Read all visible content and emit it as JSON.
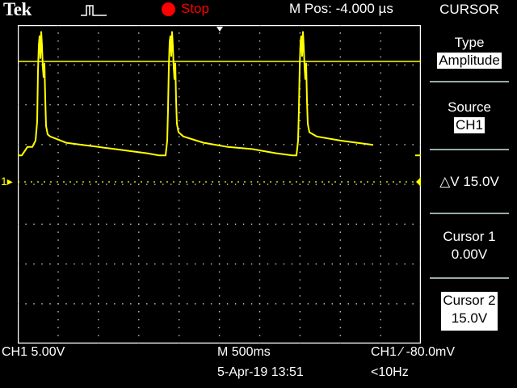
{
  "header": {
    "brand": "Tek",
    "trigger_icon": "single-pulse-icon",
    "run_state": "Stop",
    "mpos": "M Pos: -4.000 µs"
  },
  "colors": {
    "trace": "#ffff00",
    "grid": "#ffffff",
    "stop": "#ff0000",
    "border": "#ffffff"
  },
  "display": {
    "channel_marker": "1▸",
    "trace_points": [
      [
        0,
        0.62
      ],
      [
        5,
        0.62
      ],
      [
        12,
        0.58
      ],
      [
        18,
        0.58
      ],
      [
        22,
        0.55
      ],
      [
        24,
        0.46
      ],
      [
        25,
        0.22
      ],
      [
        26,
        0.1
      ],
      [
        27,
        0.05
      ],
      [
        28,
        0.16
      ],
      [
        29,
        0.03
      ],
      [
        30,
        0.1
      ],
      [
        31,
        0.2
      ],
      [
        32,
        0.25
      ],
      [
        33,
        0.18
      ],
      [
        34,
        0.35
      ],
      [
        35,
        0.48
      ],
      [
        37,
        0.52
      ],
      [
        40,
        0.53
      ],
      [
        60,
        0.56
      ],
      [
        80,
        0.57
      ],
      [
        100,
        0.58
      ],
      [
        120,
        0.59
      ],
      [
        140,
        0.6
      ],
      [
        160,
        0.61
      ],
      [
        175,
        0.62
      ],
      [
        183,
        0.62
      ],
      [
        185,
        0.55
      ],
      [
        186,
        0.4
      ],
      [
        187,
        0.2
      ],
      [
        188,
        0.08
      ],
      [
        189,
        0.05
      ],
      [
        190,
        0.15
      ],
      [
        191,
        0.03
      ],
      [
        192,
        0.1
      ],
      [
        193,
        0.2
      ],
      [
        194,
        0.26
      ],
      [
        195,
        0.18
      ],
      [
        196,
        0.36
      ],
      [
        197,
        0.47
      ],
      [
        199,
        0.51
      ],
      [
        205,
        0.53
      ],
      [
        230,
        0.56
      ],
      [
        260,
        0.58
      ],
      [
        290,
        0.59
      ],
      [
        320,
        0.61
      ],
      [
        340,
        0.62
      ],
      [
        345,
        0.62
      ],
      [
        347,
        0.55
      ],
      [
        348,
        0.4
      ],
      [
        349,
        0.2
      ],
      [
        350,
        0.08
      ],
      [
        351,
        0.05
      ],
      [
        352,
        0.15
      ],
      [
        353,
        0.03
      ],
      [
        354,
        0.1
      ],
      [
        355,
        0.2
      ],
      [
        356,
        0.26
      ],
      [
        357,
        0.18
      ],
      [
        358,
        0.36
      ],
      [
        359,
        0.47
      ],
      [
        361,
        0.51
      ],
      [
        370,
        0.53
      ],
      [
        400,
        0.55
      ],
      [
        420,
        0.56
      ],
      [
        440,
        0.57
      ]
    ]
  },
  "menu": {
    "title": "CURSOR",
    "type_label": "Type",
    "type_value": "Amplitude",
    "source_label": "Source",
    "source_value": "CH1",
    "delta_v": "△V 15.0V",
    "cursor1_label": "Cursor 1",
    "cursor1_value": "0.00V",
    "cursor2_label": "Cursor 2",
    "cursor2_value": "15.0V"
  },
  "footer": {
    "ch1_scale": "CH1  5.00V",
    "timebase": "M 500ms",
    "date_time": "5-Apr-19 13:51",
    "trigger": "CH1 ∕ -80.0mV",
    "freq": "<10Hz"
  }
}
